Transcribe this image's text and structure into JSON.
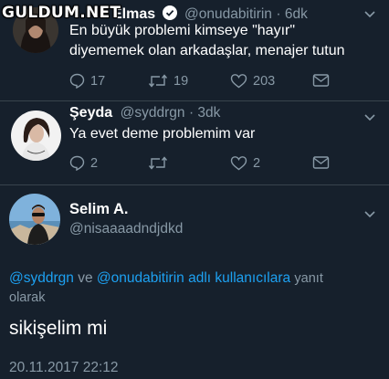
{
  "watermark": "GULDUM.NET",
  "tweets": [
    {
      "name": "Elmas",
      "handle": "@onudabitirin",
      "time": "6dk",
      "text_line1": "En büyük problemi kimseye \"hayır\"",
      "text_line2": "diyememek olan arkadaşlar, menajer tutun",
      "replies": "17",
      "retweets": "19",
      "likes": "203"
    },
    {
      "name": "Şeyda",
      "handle": "@syddrgn",
      "time": "3dk",
      "text": "Ya evet deme problemim var",
      "replies": "2",
      "likes": "2"
    }
  ],
  "focus": {
    "name": "Selim A.",
    "handle": "@nisaaaadndjdkd",
    "reply_to_mention1": "@syddrgn",
    "reply_to_and": "ve",
    "reply_to_mention2": "@onudabitirin",
    "reply_to_rest": "adlı kullanıcılara",
    "reply_to_suffix1": "yanıt",
    "reply_to_suffix2": "olarak",
    "text": "sikişelim mi",
    "datetime": "20.11.2017 22:12"
  },
  "colors": {
    "background": "#16202c",
    "muted": "#8899a6",
    "link": "#1da1f2",
    "verified": "#ffffff"
  },
  "icons": [
    "reply-icon",
    "retweet-icon",
    "like-icon",
    "dm-icon",
    "chevron-down-icon",
    "verified-icon"
  ]
}
